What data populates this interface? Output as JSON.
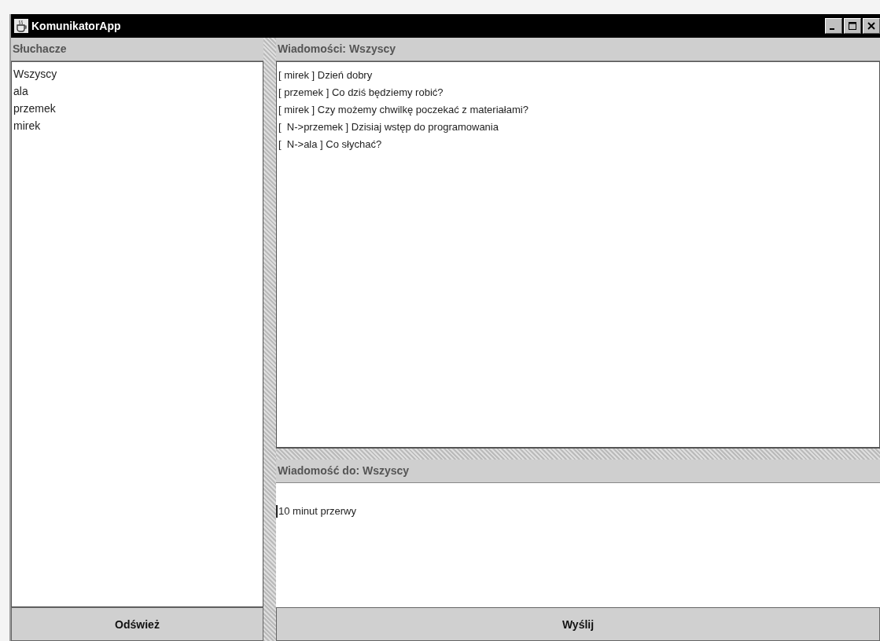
{
  "window": {
    "title": "KomunikatorApp"
  },
  "listeners": {
    "header": "Słuchacze",
    "items": [
      "Wszyscy",
      "ala",
      "przemek",
      "mirek"
    ],
    "button": "Odśwież"
  },
  "messages": {
    "header": "Wiadomości: Wszyscy",
    "lines": [
      "[ mirek ] Dzień dobry",
      "[ przemek ] Co dziś będziemy robić?",
      "[ mirek ] Czy możemy chwilkę poczekać z materiałami?",
      "[  N->przemek ] Dzisiaj wstęp do programowania",
      "[  N->ala ] Co słychać?"
    ]
  },
  "compose": {
    "header": "Wiadomość do: Wszyscy",
    "value": "10 minut przerwy",
    "button": "Wyślij"
  }
}
